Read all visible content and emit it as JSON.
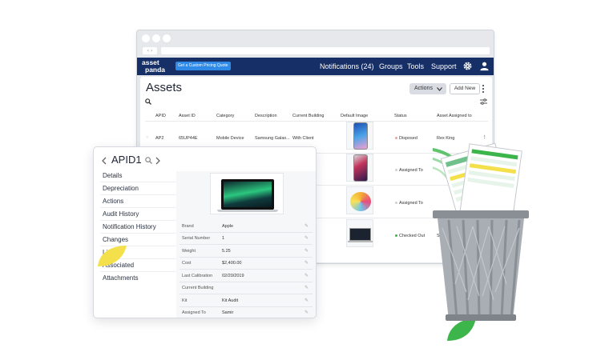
{
  "app": {
    "logo_line1": "asset",
    "logo_line2": "panda",
    "promo_label": "Get a Custom Pricing Quote",
    "nav": {
      "notifications": "Notifications (24)",
      "groups": "Groups",
      "tools": "Tools",
      "support": "Support"
    },
    "colors": {
      "nav_bg": "#162f66",
      "accent": "#2e8ae6",
      "leaf_yellow": "#f3e04b",
      "leaf_green": "#3cb54a"
    }
  },
  "assets": {
    "title": "Assets",
    "actions_label": "Actions",
    "add_new_label": "Add New",
    "columns": [
      "APID",
      "Asset ID",
      "Category",
      "Description",
      "Current Building",
      "Default Image",
      "Status",
      "Asset Assigned to"
    ],
    "rows": [
      {
        "apid": "AP2",
        "asset_id": "65UP44E",
        "category": "Mobile Device",
        "description": "Samsung Galax...",
        "building": "With Client",
        "status": "Disposed",
        "assigned": "Rex King"
      },
      {
        "apid": "",
        "asset_id": "",
        "category": "",
        "description": "",
        "building": "",
        "status": "Assigned To",
        "assigned": ""
      },
      {
        "apid": "",
        "asset_id": "",
        "category": "",
        "description": "",
        "building": "",
        "status": "Assigned To",
        "assigned": ""
      },
      {
        "apid": "",
        "asset_id": "",
        "category": "",
        "description": "",
        "building": "",
        "status": "Checked Out",
        "assigned": "Sam"
      }
    ]
  },
  "panel": {
    "title": "APID1",
    "menu": [
      "Details",
      "Depreciation",
      "Actions",
      "Audit History",
      "Notification History",
      "Changes",
      "Li",
      "Associated",
      "Attachments"
    ],
    "fields": [
      {
        "label": "Brand",
        "value": "Apple"
      },
      {
        "label": "Serial Number",
        "value": "1"
      },
      {
        "label": "Weight",
        "value": "5.25"
      },
      {
        "label": "Cost",
        "value": "$2,400.00"
      },
      {
        "label": "Last Calibration",
        "value": "02/20/2019"
      },
      {
        "label": "Current Building",
        "value": ""
      },
      {
        "label": "Kit",
        "value": "Kit Audit"
      },
      {
        "label": "Assigned To",
        "value": "Samir"
      }
    ]
  }
}
